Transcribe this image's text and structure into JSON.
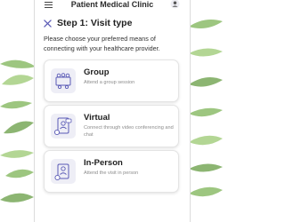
{
  "app": {
    "title": "Patient Medical Clinic"
  },
  "header": {
    "menu_icon": "hamburger-menu-icon",
    "user_icon": "user-icon"
  },
  "step": {
    "title": "Step 1: Visit type",
    "close_icon": "close-icon"
  },
  "instructions": "Please choose your preferred means of connecting with your healthcare provider.",
  "options": [
    {
      "title": "Group",
      "description": "Attend a group session",
      "icon": "group-session-icon"
    },
    {
      "title": "Virtual",
      "description": "Connect through video conferencing and chat",
      "icon": "video-chat-icon"
    },
    {
      "title": "In-Person",
      "description": "Attend the visit in person",
      "icon": "in-person-visit-icon"
    }
  ],
  "colors": {
    "accent": "#5b5bb6",
    "icon_bg": "#eeeef6",
    "leaf": "#8fbf6a"
  }
}
